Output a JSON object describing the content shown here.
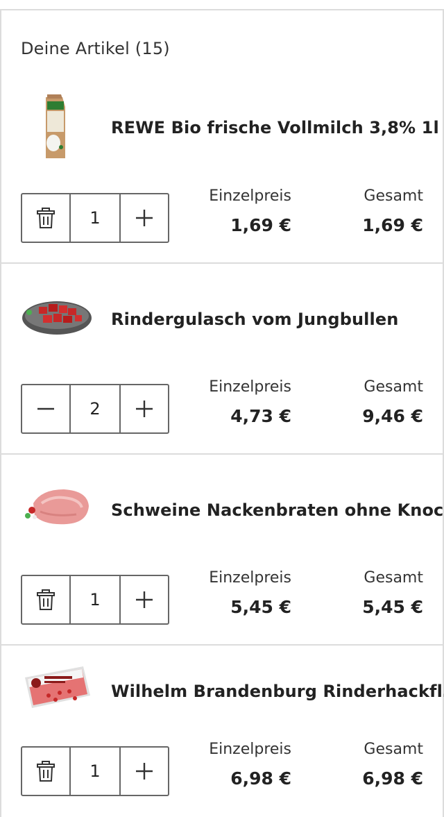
{
  "cart": {
    "heading": "Deine Artikel (15)",
    "unit_price_label": "Einzelpreis",
    "total_label": "Gesamt"
  },
  "items": [
    {
      "name": "REWE Bio frische Vollmilch 3,8% 1l",
      "qty": "1",
      "unit_price": "1,69 €",
      "total": "1,69 €",
      "left_control": "trash-icon"
    },
    {
      "name": "Rindergulasch vom Jungbullen",
      "qty": "2",
      "unit_price": "4,73 €",
      "total": "9,46 €",
      "left_control": "minus-icon"
    },
    {
      "name": "Schweine Nackenbraten ohne Knoc…",
      "qty": "1",
      "unit_price": "5,45 €",
      "total": "5,45 €",
      "left_control": "trash-icon"
    },
    {
      "name": "Wilhelm Brandenburg Rinderhackfl…",
      "qty": "1",
      "unit_price": "6,98 €",
      "total": "6,98 €",
      "left_control": "trash-icon"
    }
  ]
}
